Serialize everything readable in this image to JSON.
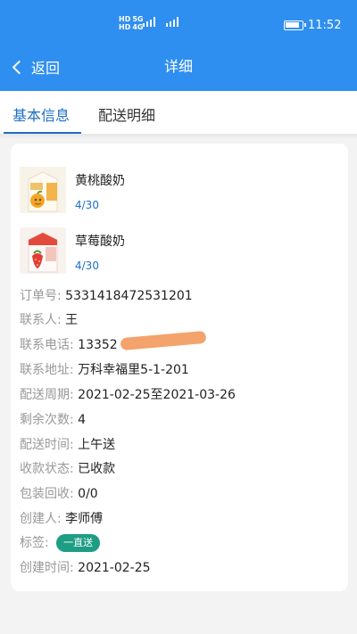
{
  "status_bar": {
    "net_labels": [
      "HD",
      "HD"
    ],
    "net_types": [
      "5G",
      "4G"
    ],
    "time": "11:52"
  },
  "header": {
    "back_label": "返回",
    "title": "详细"
  },
  "tabs": [
    {
      "label": "基本信息",
      "active": true
    },
    {
      "label": "配送明细",
      "active": false
    }
  ],
  "products": [
    {
      "name": "黄桃酸奶",
      "qty": "4/30",
      "image_icon": "yellow-peach-yogurt-icon"
    },
    {
      "name": "草莓酸奶",
      "qty": "4/30",
      "image_icon": "strawberry-yogurt-icon"
    }
  ],
  "order": {
    "order_no_label": "订单号:",
    "order_no": "5331418472531201",
    "contact_label": "联系人:",
    "contact": "王",
    "phone_label": "联系电话:",
    "phone": "13352",
    "address_label": "联系地址:",
    "address": "万科幸福里5-1-201",
    "period_label": "配送周期:",
    "period": "2021-02-25至2021-03-26",
    "remaining_label": "剩余次数:",
    "remaining": "4",
    "delivery_time_label": "配送时间:",
    "delivery_time": "上午送",
    "payment_status_label": "收款状态:",
    "payment_status": "已收款",
    "package_label": "包装回收:",
    "package": "0/0",
    "creator_label": "创建人:",
    "creator": "李师傅",
    "tag_label": "标签:",
    "tag": "一直送",
    "created_label": "创建时间:",
    "created": "2021-02-25"
  },
  "colors": {
    "accent": "#2f8ff0",
    "tab_active": "#1e6fc4",
    "tag": "#1d9d83",
    "redaction": "#f3a36b"
  }
}
